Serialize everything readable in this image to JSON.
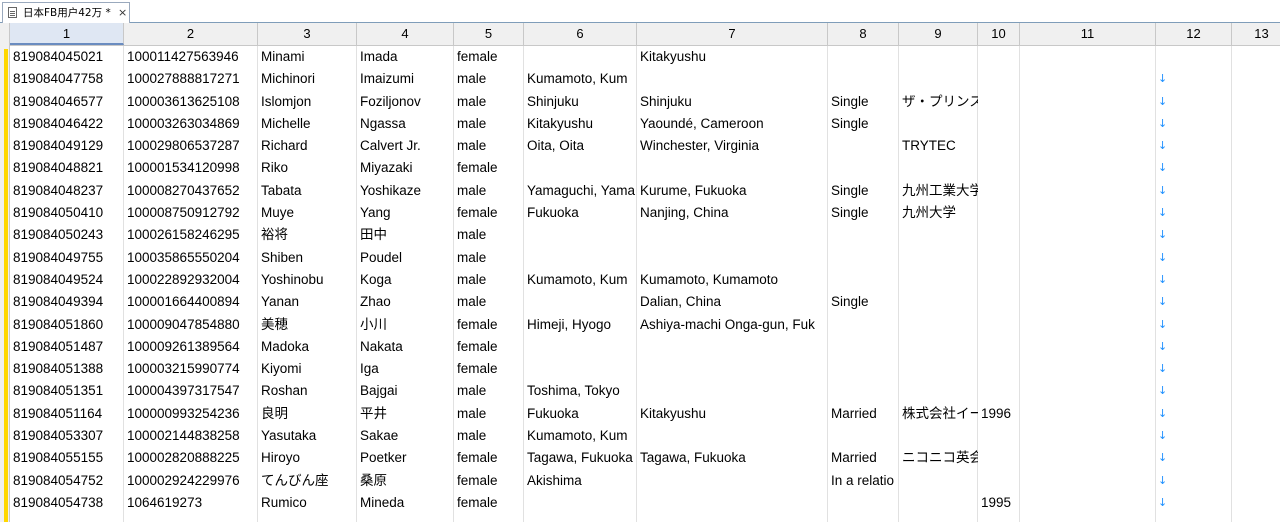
{
  "tab": {
    "title": "日本FB用户42万 *",
    "close": "×",
    "icon": "document-icon"
  },
  "columns": [
    "1",
    "2",
    "3",
    "4",
    "5",
    "6",
    "7",
    "8",
    "9",
    "10",
    "11",
    "12",
    "13"
  ],
  "rows": [
    [
      "819084045021",
      "100011427563946",
      "Minami",
      "Imada",
      "female",
      "",
      "Kitakyushu",
      "",
      "",
      "",
      ""
    ],
    [
      "819084047758",
      "100027888817271",
      "Michinori",
      "Imaizumi",
      "male",
      "Kumamoto, Kum",
      "",
      "",
      "",
      "",
      ""
    ],
    [
      "819084046577",
      "100003613625108",
      "Islomjon",
      "Foziljonov",
      "male",
      "Shinjuku",
      "Shinjuku",
      "Single",
      "ザ・プリンス",
      "",
      ""
    ],
    [
      "819084046422",
      "100003263034869",
      "Michelle",
      "Ngassa",
      "male",
      "Kitakyushu",
      "Yaoundé, Cameroon",
      "Single",
      "",
      "",
      ""
    ],
    [
      "819084049129",
      "100029806537287",
      "Richard",
      "Calvert Jr.",
      "male",
      "Oita, Oita",
      "Winchester, Virginia",
      "",
      "TRYTEC",
      "",
      ""
    ],
    [
      "819084048821",
      "100001534120998",
      "Riko",
      "Miyazaki",
      "female",
      "",
      "",
      "",
      "",
      "",
      ""
    ],
    [
      "819084048237",
      "100008270437652",
      "Tabata",
      "Yoshikaze",
      "male",
      "Yamaguchi, Yama",
      "Kurume, Fukuoka",
      "Single",
      "九州工業大学",
      "",
      ""
    ],
    [
      "819084050410",
      "100008750912792",
      "Muye",
      "Yang",
      "female",
      "Fukuoka",
      "Nanjing, China",
      "Single",
      "九州大学",
      "",
      ""
    ],
    [
      "819084050243",
      "100026158246295",
      "裕将",
      "田中",
      "male",
      "",
      "",
      "",
      "",
      "",
      ""
    ],
    [
      "819084049755",
      "100035865550204",
      "Shiben",
      "Poudel",
      "male",
      "",
      "",
      "",
      "",
      "",
      ""
    ],
    [
      "819084049524",
      "100022892932004",
      "Yoshinobu",
      "Koga",
      "male",
      "Kumamoto, Kum",
      "Kumamoto, Kumamoto",
      "",
      "",
      "",
      ""
    ],
    [
      "819084049394",
      "100001664400894",
      "Yanan",
      "Zhao",
      "male",
      "",
      "Dalian, China",
      "Single",
      "",
      "",
      ""
    ],
    [
      "819084051860",
      "100009047854880",
      "美穂",
      "小川",
      "female",
      "Himeji, Hyogo",
      "Ashiya-machi Onga-gun, Fuk",
      "",
      "",
      "",
      ""
    ],
    [
      "819084051487",
      "100009261389564",
      "Madoka",
      "Nakata",
      "female",
      "",
      "",
      "",
      "",
      "",
      ""
    ],
    [
      "819084051388",
      "100003215990774",
      "Kiyomi",
      "Iga",
      "female",
      "",
      "",
      "",
      "",
      "",
      ""
    ],
    [
      "819084051351",
      "100004397317547",
      "Roshan",
      "Bajgai",
      "male",
      "Toshima, Tokyo",
      "",
      "",
      "",
      "",
      ""
    ],
    [
      "819084051164",
      "100000993254236",
      "良明",
      "平井",
      "male",
      "Fukuoka",
      "Kitakyushu",
      "Married",
      "株式会社イー",
      "1996",
      ""
    ],
    [
      "819084053307",
      "100002144838258",
      "Yasutaka",
      "Sakae",
      "male",
      "Kumamoto, Kum",
      "",
      "",
      "",
      "",
      ""
    ],
    [
      "819084055155",
      "100002820888225",
      "Hiroyo",
      "Poetker",
      "female",
      "Tagawa, Fukuoka",
      "Tagawa, Fukuoka",
      "Married",
      "ニコニコ英会",
      "",
      ""
    ],
    [
      "819084054752",
      "100002924229976",
      "てんびん座",
      "桑原",
      "female",
      "Akishima",
      "",
      "In a relatio",
      "",
      "",
      ""
    ],
    [
      "819084054738",
      "1064619273",
      "Rumico",
      "Mineda",
      "female",
      "",
      "",
      "",
      "",
      "1995",
      ""
    ]
  ],
  "arrow_icon": "down-arrow-icon",
  "arrow_glyph": "↓",
  "accent": "#ffd700"
}
